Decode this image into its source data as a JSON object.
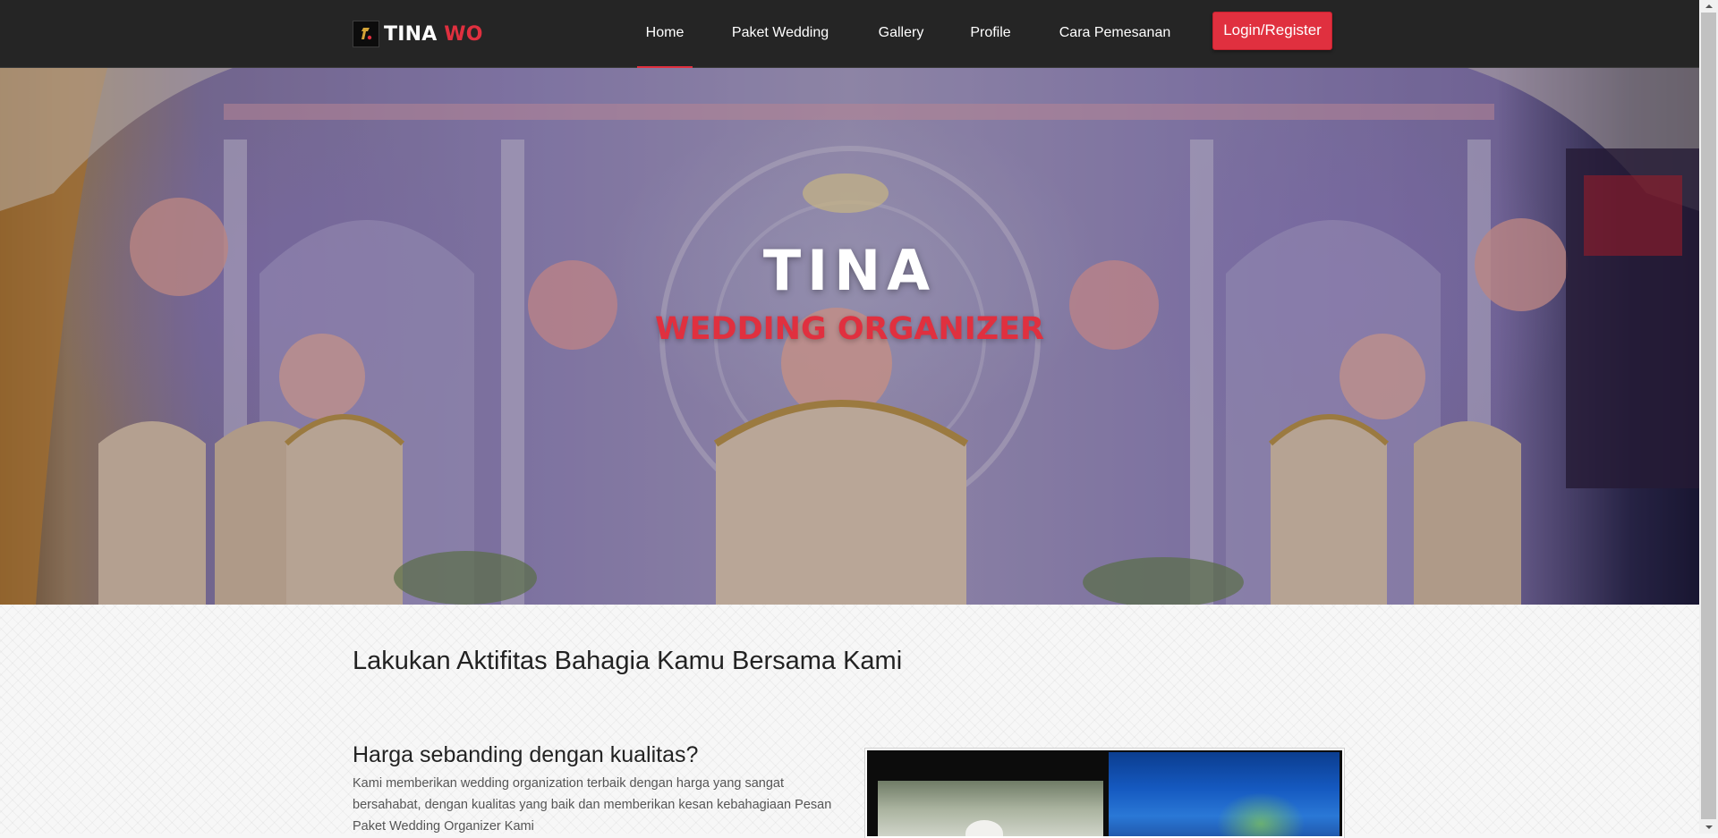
{
  "navbar": {
    "brand": {
      "name": "TINA",
      "accent": "WO"
    },
    "links": [
      {
        "label": "Home",
        "active": true
      },
      {
        "label": "Paket Wedding",
        "active": false
      },
      {
        "label": "Gallery",
        "active": false
      },
      {
        "label": "Profile",
        "active": false
      },
      {
        "label": "Cara Pemesanan",
        "active": false
      }
    ],
    "login_label": "Login/Register"
  },
  "hero": {
    "title": "TINA",
    "subtitle": "WEDDING ORGANIZER"
  },
  "content": {
    "heading": "Lakukan Aktifitas Bahagia Kamu Bersama Kami",
    "feature": {
      "title": "Harga sebanding dengan kualitas?",
      "description": "Kami memberikan wedding organization terbaik dengan harga yang sangat bersahabat, dengan kualitas yang baik dan memberikan kesan kebahagiaan Pesan Paket Wedding Organizer Kami"
    }
  },
  "colors": {
    "accent": "#e0303f",
    "navbar_bg": "#252525",
    "text_dark": "#222222",
    "text_muted": "#555555"
  },
  "icons": {
    "brand_logo": "brand-logo-icon",
    "scroll_up": "scroll-up-arrow-icon",
    "scroll_down": "scroll-down-arrow-icon"
  }
}
